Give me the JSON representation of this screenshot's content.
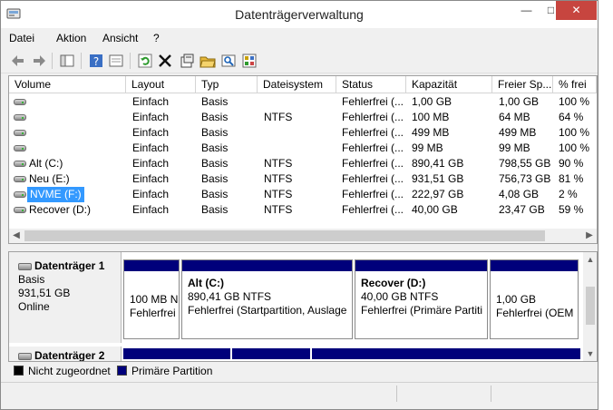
{
  "window": {
    "title": "Datenträgerverwaltung"
  },
  "menu": [
    "Datei",
    "Aktion",
    "Ansicht",
    "?"
  ],
  "volume_list": {
    "columns": [
      "Volume",
      "Layout",
      "Typ",
      "Dateisystem",
      "Status",
      "Kapazität",
      "Freier Sp...",
      "% frei"
    ],
    "rows": [
      {
        "volume": "",
        "layout": "Einfach",
        "typ": "Basis",
        "fs": "",
        "status": "Fehlerfrei (...",
        "kap": "1,00 GB",
        "frei": "1,00 GB",
        "pct": "100 %"
      },
      {
        "volume": "",
        "layout": "Einfach",
        "typ": "Basis",
        "fs": "NTFS",
        "status": "Fehlerfrei (...",
        "kap": "100 MB",
        "frei": "64 MB",
        "pct": "64 %"
      },
      {
        "volume": "",
        "layout": "Einfach",
        "typ": "Basis",
        "fs": "",
        "status": "Fehlerfrei (...",
        "kap": "499 MB",
        "frei": "499 MB",
        "pct": "100 %"
      },
      {
        "volume": "",
        "layout": "Einfach",
        "typ": "Basis",
        "fs": "",
        "status": "Fehlerfrei (...",
        "kap": "99 MB",
        "frei": "99 MB",
        "pct": "100 %"
      },
      {
        "volume": "Alt (C:)",
        "layout": "Einfach",
        "typ": "Basis",
        "fs": "NTFS",
        "status": "Fehlerfrei (...",
        "kap": "890,41 GB",
        "frei": "798,55 GB",
        "pct": "90 %"
      },
      {
        "volume": "Neu (E:)",
        "layout": "Einfach",
        "typ": "Basis",
        "fs": "NTFS",
        "status": "Fehlerfrei (...",
        "kap": "931,51 GB",
        "frei": "756,73 GB",
        "pct": "81 %"
      },
      {
        "volume": "NVME (F:)",
        "layout": "Einfach",
        "typ": "Basis",
        "fs": "NTFS",
        "status": "Fehlerfrei (...",
        "kap": "222,97 GB",
        "frei": "4,08 GB",
        "pct": "2 %"
      },
      {
        "volume": "Recover (D:)",
        "layout": "Einfach",
        "typ": "Basis",
        "fs": "NTFS",
        "status": "Fehlerfrei (...",
        "kap": "40,00 GB",
        "frei": "23,47 GB",
        "pct": "59 %"
      }
    ]
  },
  "disks": [
    {
      "name": "Datenträger 1",
      "type": "Basis",
      "size": "931,51 GB",
      "state": "Online",
      "partitions": [
        {
          "name": "",
          "line1": "100 MB N",
          "line2": "Fehlerfrei"
        },
        {
          "name": "Alt  (C:)",
          "line1": "890,41 GB NTFS",
          "line2": "Fehlerfrei (Startpartition, Auslage"
        },
        {
          "name": "Recover  (D:)",
          "line1": "40,00 GB NTFS",
          "line2": "Fehlerfrei (Primäre Partiti"
        },
        {
          "name": "",
          "line1": "1,00 GB",
          "line2": "Fehlerfrei (OEM"
        }
      ]
    },
    {
      "name": "Datenträger 2"
    }
  ],
  "legend": [
    {
      "label": "Nicht zugeordnet",
      "color": "#000000"
    },
    {
      "label": "Primäre Partition",
      "color": "#00007b"
    }
  ]
}
